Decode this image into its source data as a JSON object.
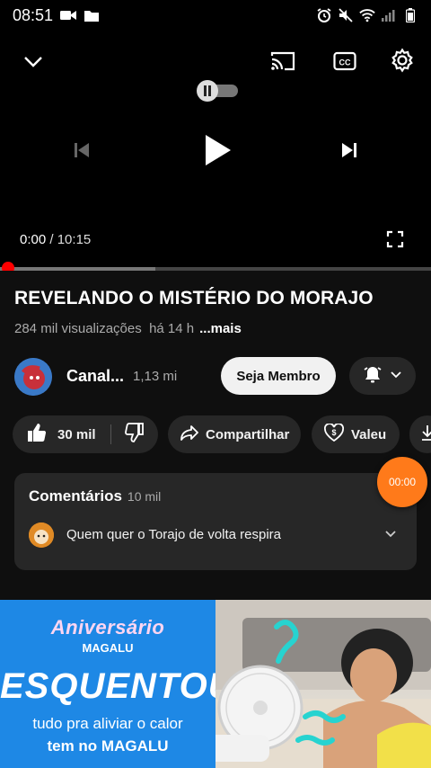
{
  "status_bar": {
    "time": "08:51",
    "left_icons": [
      "video-camera-icon",
      "folder-icon"
    ],
    "right_icons": [
      "alarm-icon",
      "mute-icon",
      "wifi-icon",
      "signal-icon",
      "battery-icon"
    ]
  },
  "player": {
    "current_time": "0:00",
    "separator": " / ",
    "duration": "10:15",
    "progress_fraction": 0.0,
    "buffered_fraction": 0.36,
    "state": "paused"
  },
  "video": {
    "title": "REVELANDO O MISTÉRIO DO MORAJO",
    "views": "284 mil visualizações",
    "age": "há 14 h",
    "more_label": "...mais"
  },
  "channel": {
    "name": "Canal...",
    "subscribers": "1,13 mi",
    "join_label": "Seja Membro"
  },
  "actions": {
    "like_count": "30 mil",
    "share_label": "Compartilhar",
    "thanks_label": "Valeu"
  },
  "comments": {
    "title": "Comentários",
    "count": "10 mil",
    "top_comment": "Quem quer o Torajo de volta respira"
  },
  "floating_timer": "00:00",
  "ad": {
    "headline_small": "Aniversário",
    "brand_small": "MAGALU",
    "headline": "ESQUENTOU",
    "subline": "tudo pra aliviar o calor",
    "tagline": "tem no MAGALU"
  },
  "colors": {
    "accent_red": "#ff0000",
    "orange_timer": "#ff7a1a",
    "ad_blue": "#1e88e5",
    "surface": "#272727",
    "background": "#0f0f0f"
  }
}
